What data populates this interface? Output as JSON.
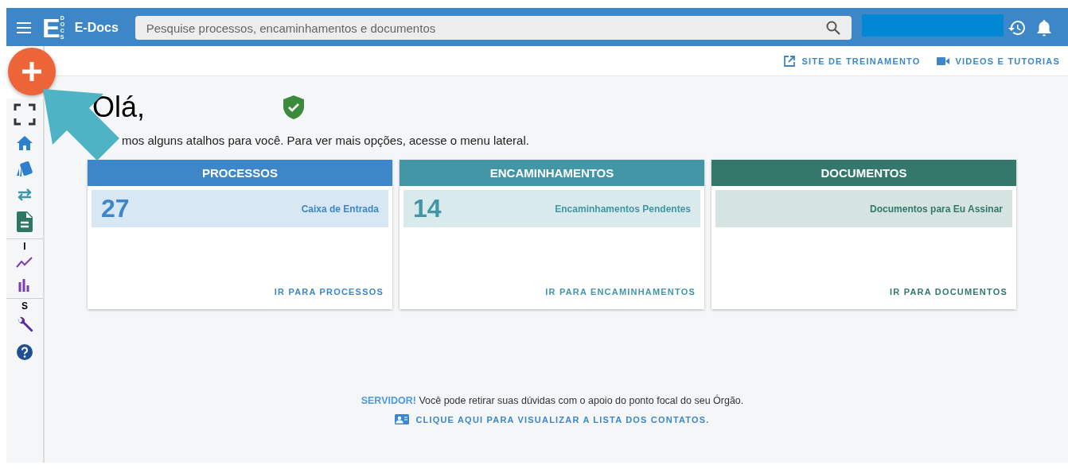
{
  "header": {
    "app_name": "E-Docs",
    "logo_letter": "E",
    "logo_sub": "DOCS",
    "search": {
      "placeholder": "Pesquise processos, encaminhamentos e documentos"
    }
  },
  "toolbar": {
    "links": [
      "SITE DE TREINAMENTO",
      "VIDEOS E TUTORIAS"
    ]
  },
  "sidebar": {
    "section_labels": [
      "I",
      "S"
    ]
  },
  "greeting": {
    "title": "Olá,",
    "subtitle": "mos alguns atalhos para você. Para ver mais opções, acesse o menu lateral."
  },
  "cards": [
    {
      "title": "PROCESSOS",
      "color": "#3d87c8",
      "count": "27",
      "label": "Caixa de Entrada",
      "link": "IR PARA PROCESSOS"
    },
    {
      "title": "ENCAMINHAMENTOS",
      "color": "#4396a6",
      "count": "14",
      "label": "Encaminhamentos Pendentes",
      "link": "IR PARA ENCAMINHAMENTOS"
    },
    {
      "title": "DOCUMENTOS",
      "color": "#33786a",
      "label": "Documentos para Eu Assinar",
      "link": "IR PARA DOCUMENTOS"
    }
  ],
  "footer": {
    "highlight": "SERVIDOR!",
    "message": "Você pode retirar suas dúvidas com o apoio do ponto focal do seu Órgão.",
    "link": "CLIQUE AQUI PARA VISUALIZAR A LISTA DOS CONTATOS."
  }
}
